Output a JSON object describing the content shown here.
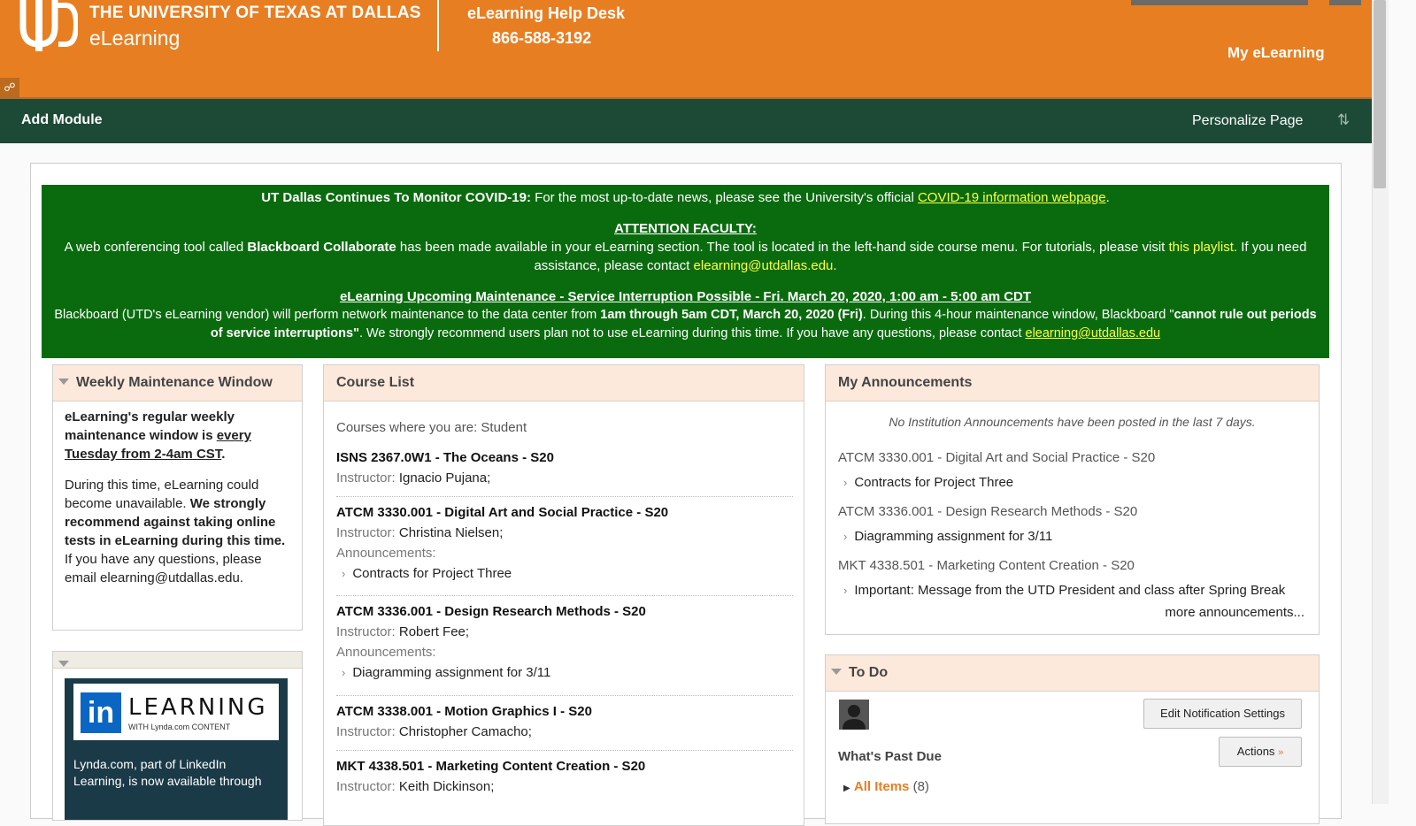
{
  "header": {
    "logo_text": "UTD",
    "brand_line1": "THE UNIVERSITY OF TEXAS AT DALLAS",
    "brand_line2": "eLearning",
    "help_title": "eLearning Help Desk",
    "help_phone": "866-588-3192",
    "my_elearning": "My eLearning"
  },
  "toolbar": {
    "add_module": "Add Module",
    "personalize": "Personalize Page"
  },
  "banner": {
    "covid_bold": "UT Dallas Continues To Monitor COVID-19:",
    "covid_text": " For the most up-to-date news, please see the University's official ",
    "covid_link": "COVID-19 information webpage",
    "covid_end": ".",
    "faculty_heading": "ATTENTION FACULTY:",
    "faculty_text1": "A web conferencing tool called ",
    "faculty_bold": "Blackboard Collaborate",
    "faculty_text2": " has been made available in your eLearning section. The tool is located in the left-hand side course menu. For tutorials, please visit ",
    "faculty_link": "this playlist.",
    "faculty_text3": " If you need assistance, please contact ",
    "faculty_email": "elearning@utdallas.edu",
    "faculty_end": ".",
    "maint_heading": "eLearning Upcoming Maintenance - Service Interruption Possible - Fri. March 20, 2020, 1:00 am - 5:00 am CDT",
    "maint_text1": "Blackboard (UTD's eLearning vendor) will perform network maintenance to the data center from ",
    "maint_bold1": "1am through 5am CDT, March 20, 2020 (Fri)",
    "maint_text2": ". During this 4-hour maintenance window, Blackboard \"",
    "maint_bold2": "cannot rule out periods of service interruptions\"",
    "maint_text3": ". We strongly recommend users plan not to use eLearning during this time. If you have any questions, please contact ",
    "maint_email": "elearning@utdallas.edu"
  },
  "weekly": {
    "title": "Weekly Maintenance Window",
    "p1_bold": "eLearning's regular weekly maintenance window is ",
    "p1_underline": "every Tuesday from 2-4am CST",
    "p1_end": ".",
    "p2_text": "During this time, eLearning could become unavailable. ",
    "p2_bold": "We strongly recommend against taking online tests in eLearning during this time.",
    "p2_text2": " If you have any questions, please email elearning@utdallas.edu."
  },
  "linkedin": {
    "in": "in",
    "word": "LEARNING",
    "sub": "WITH Lynda.com CONTENT",
    "text": "Lynda.com, part of LinkedIn Learning, is now available through"
  },
  "course_list": {
    "title": "Course List",
    "role_line": "Courses where you are: Student",
    "instructor_label": "Instructor: ",
    "announcements_label": "Announcements:",
    "courses": [
      {
        "title": "ISNS 2367.0W1 - The Oceans - S20",
        "instructor": "Ignacio Pujana;",
        "announcement": ""
      },
      {
        "title": "ATCM 3330.001 - Digital Art and Social Practice - S20",
        "instructor": "Christina Nielsen;",
        "announcement": "Contracts for Project Three"
      },
      {
        "title": "ATCM 3336.001 - Design Research Methods - S20",
        "instructor": "Robert Fee;",
        "announcement": "Diagramming assignment for 3/11"
      },
      {
        "title": "ATCM 3338.001 - Motion Graphics I - S20",
        "instructor": "Christopher Camacho;",
        "announcement": ""
      },
      {
        "title": "MKT 4338.501 - Marketing Content Creation - S20",
        "instructor": "Keith Dickinson;",
        "announcement": ""
      }
    ]
  },
  "announcements": {
    "title": "My Announcements",
    "none_note": "No Institution Announcements have been posted in the last 7 days.",
    "items": [
      {
        "course": "ATCM 3330.001 - Digital Art and Social Practice - S20",
        "item": "Contracts for Project Three"
      },
      {
        "course": "ATCM 3336.001 - Design Research Methods - S20",
        "item": "Diagramming assignment for 3/11"
      },
      {
        "course": "MKT 4338.501 - Marketing Content Creation - S20",
        "item": "Important: Message from the UTD President and class after Spring Break"
      }
    ],
    "more": "more announcements..."
  },
  "todo": {
    "title": "To Do",
    "edit_settings": "Edit Notification Settings",
    "actions": "Actions",
    "past_due": "What's Past Due",
    "all_items": "All Items",
    "all_count": "(8)"
  }
}
